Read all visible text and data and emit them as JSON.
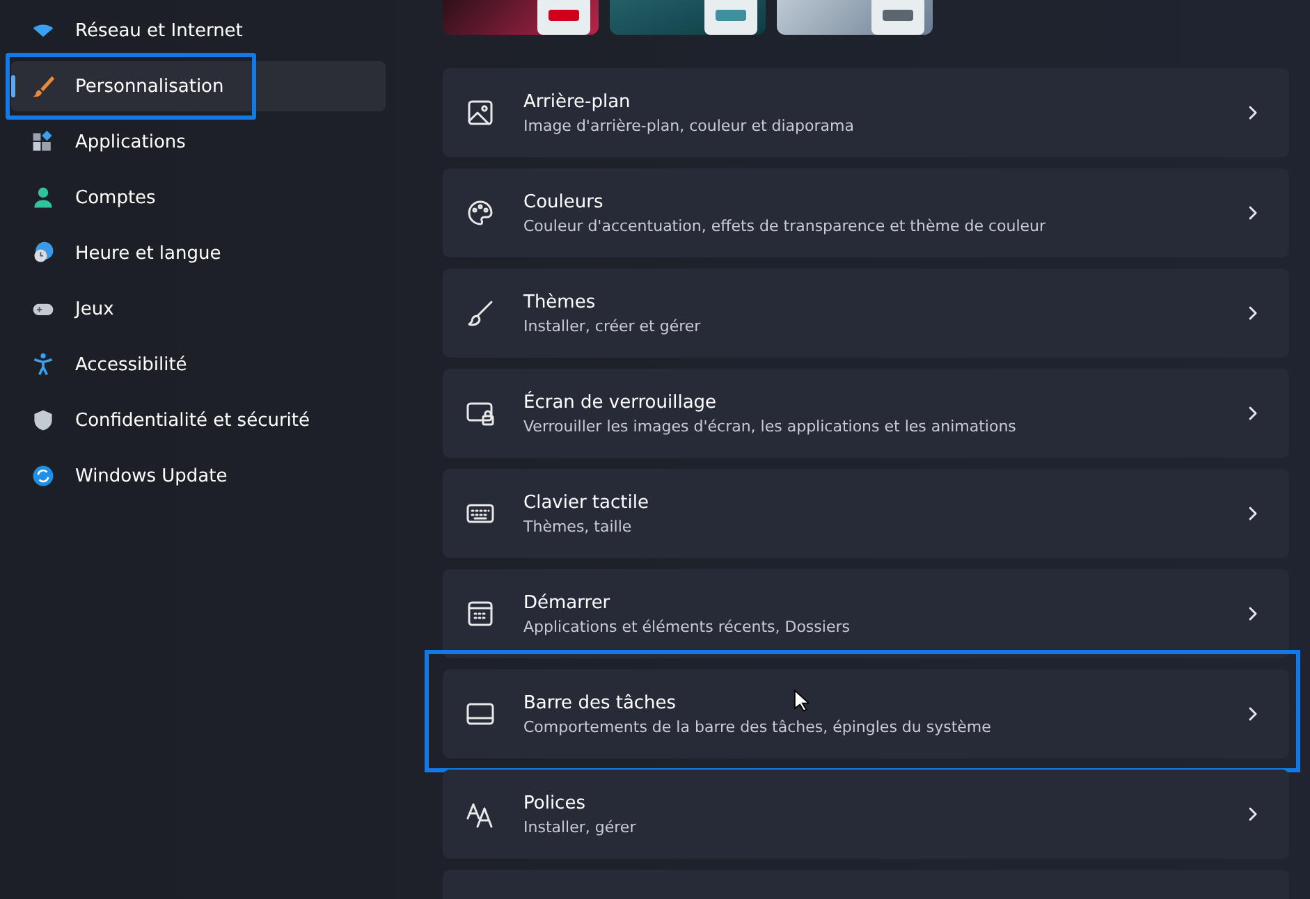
{
  "sidebar": {
    "items": [
      {
        "label": "Réseau et Internet",
        "selected": false,
        "highlighted": false
      },
      {
        "label": "Personnalisation",
        "selected": true,
        "highlighted": true
      },
      {
        "label": "Applications",
        "selected": false,
        "highlighted": false
      },
      {
        "label": "Comptes",
        "selected": false,
        "highlighted": false
      },
      {
        "label": "Heure et langue",
        "selected": false,
        "highlighted": false
      },
      {
        "label": "Jeux",
        "selected": false,
        "highlighted": false
      },
      {
        "label": "Accessibilité",
        "selected": false,
        "highlighted": false
      },
      {
        "label": "Confidentialité et sécurité",
        "selected": false,
        "highlighted": false
      },
      {
        "label": "Windows Update",
        "selected": false,
        "highlighted": false
      }
    ]
  },
  "themes": [
    {
      "color": "#d0021b"
    },
    {
      "color": "#3f8f9e"
    },
    {
      "color": "#5b6670"
    }
  ],
  "settings": [
    {
      "title": "Arrière-plan",
      "subtitle": "Image d'arrière-plan, couleur et diaporama",
      "highlighted": false
    },
    {
      "title": "Couleurs",
      "subtitle": "Couleur d'accentuation, effets de transparence et thème de couleur",
      "highlighted": false
    },
    {
      "title": "Thèmes",
      "subtitle": "Installer, créer et gérer",
      "highlighted": false
    },
    {
      "title": "Écran de verrouillage",
      "subtitle": "Verrouiller les images d'écran, les applications et les animations",
      "highlighted": false
    },
    {
      "title": "Clavier tactile",
      "subtitle": "Thèmes, taille",
      "highlighted": false
    },
    {
      "title": "Démarrer",
      "subtitle": "Applications et éléments récents, Dossiers",
      "highlighted": false
    },
    {
      "title": "Barre des tâches",
      "subtitle": "Comportements de la barre des tâches, épingles du système",
      "highlighted": true
    },
    {
      "title": "Polices",
      "subtitle": "Installer, gérer",
      "highlighted": false
    }
  ]
}
